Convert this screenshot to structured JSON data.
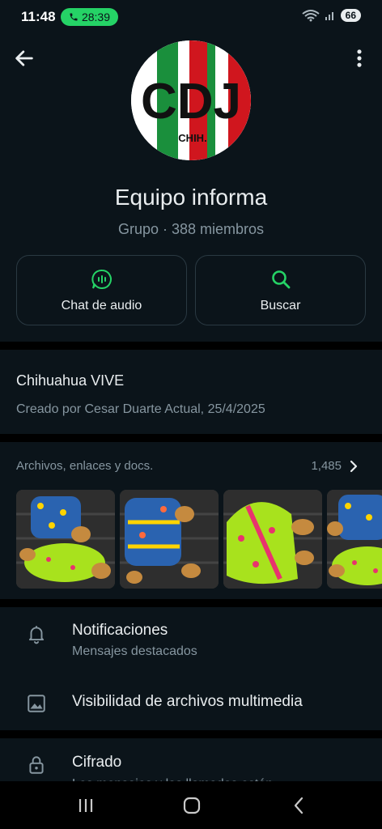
{
  "status_bar": {
    "time": "11:48",
    "call_timer": "28:39",
    "battery": "66"
  },
  "header": {
    "group_name": "Equipo informa",
    "group_meta": "Grupo · 388 miembros",
    "avatar_text": "CDJ",
    "avatar_subtext": "CHIH."
  },
  "actions": {
    "audio_chat_label": "Chat de audio",
    "search_label": "Buscar"
  },
  "description": {
    "title": "Chihuahua VIVE",
    "created": "Creado por Cesar Duarte Actual, 25/4/2025"
  },
  "media": {
    "label": "Archivos, enlaces y docs.",
    "count": "1,485"
  },
  "settings": {
    "notifications_title": "Notificaciones",
    "notifications_sub": "Mensajes destacados",
    "visibility_title": "Visibilidad de archivos multimedia",
    "encryption_title": "Cifrado",
    "encryption_sub": "Los mensajes y las llamadas están"
  },
  "colors": {
    "accent": "#25d366",
    "background": "#0b141a",
    "muted_text": "#8696a0"
  },
  "icons": [
    "back-arrow-icon",
    "more-vertical-icon",
    "audio-chat-icon",
    "search-icon",
    "chevron-right-icon",
    "bell-icon",
    "image-icon",
    "lock-icon"
  ]
}
